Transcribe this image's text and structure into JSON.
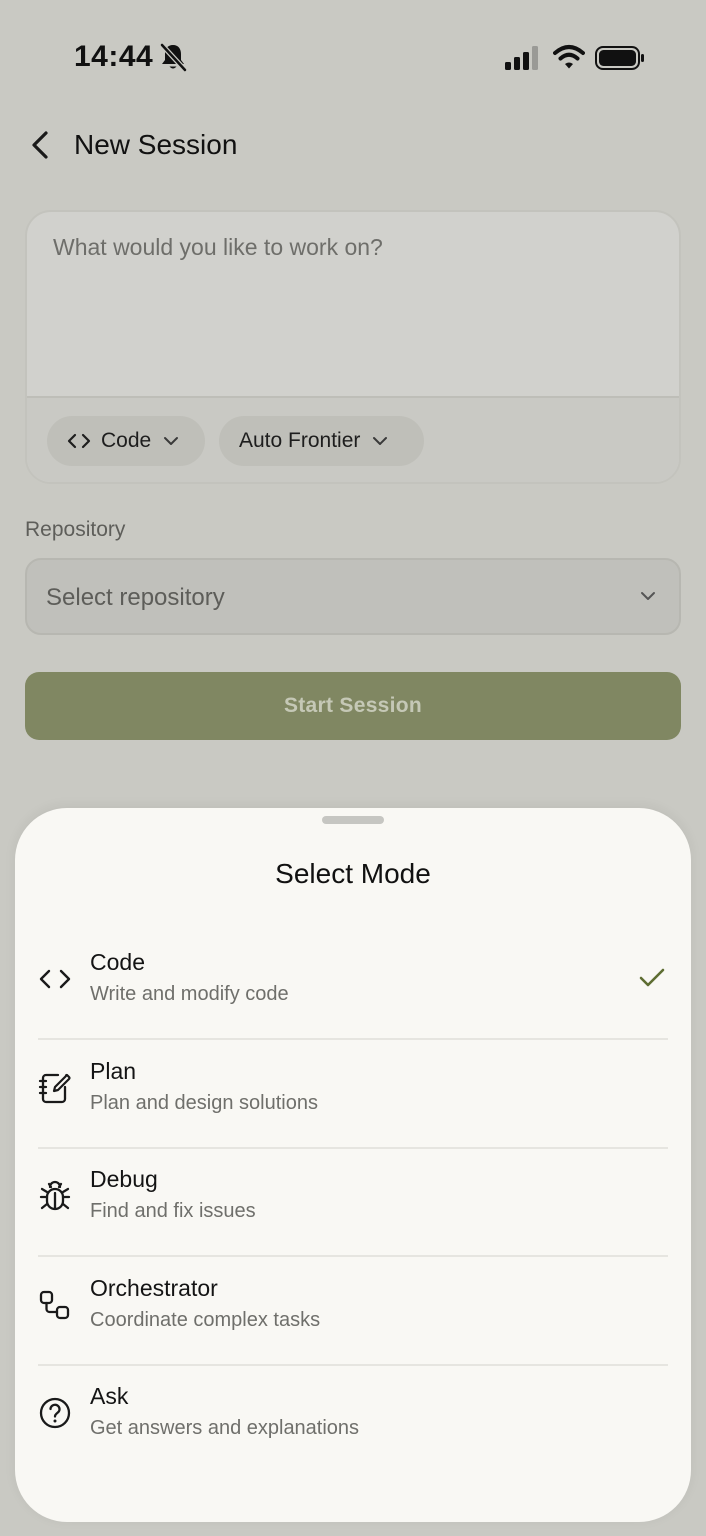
{
  "status_bar": {
    "time": "14:44"
  },
  "header": {
    "title": "New Session"
  },
  "prompt": {
    "placeholder": "What would you like to work on?",
    "mode_chip": "Code",
    "model_chip": "Auto Frontier"
  },
  "repository": {
    "label": "Repository",
    "placeholder": "Select repository"
  },
  "start_button": "Start Session",
  "sheet": {
    "title": "Select Mode",
    "modes": [
      {
        "label": "Code",
        "description": "Write and modify code",
        "icon": "code-icon",
        "selected": true
      },
      {
        "label": "Plan",
        "description": "Plan and design solutions",
        "icon": "notebook-pen-icon",
        "selected": false
      },
      {
        "label": "Debug",
        "description": "Find and fix issues",
        "icon": "bug-icon",
        "selected": false
      },
      {
        "label": "Orchestrator",
        "description": "Coordinate complex tasks",
        "icon": "workflow-icon",
        "selected": false
      },
      {
        "label": "Ask",
        "description": "Get answers and explanations",
        "icon": "help-circle-icon",
        "selected": false
      }
    ]
  },
  "colors": {
    "background_dimmed": "#c9c9c3",
    "accent": "#808762",
    "check": "#5e6d32",
    "sheet_bg": "#f9f8f4"
  }
}
